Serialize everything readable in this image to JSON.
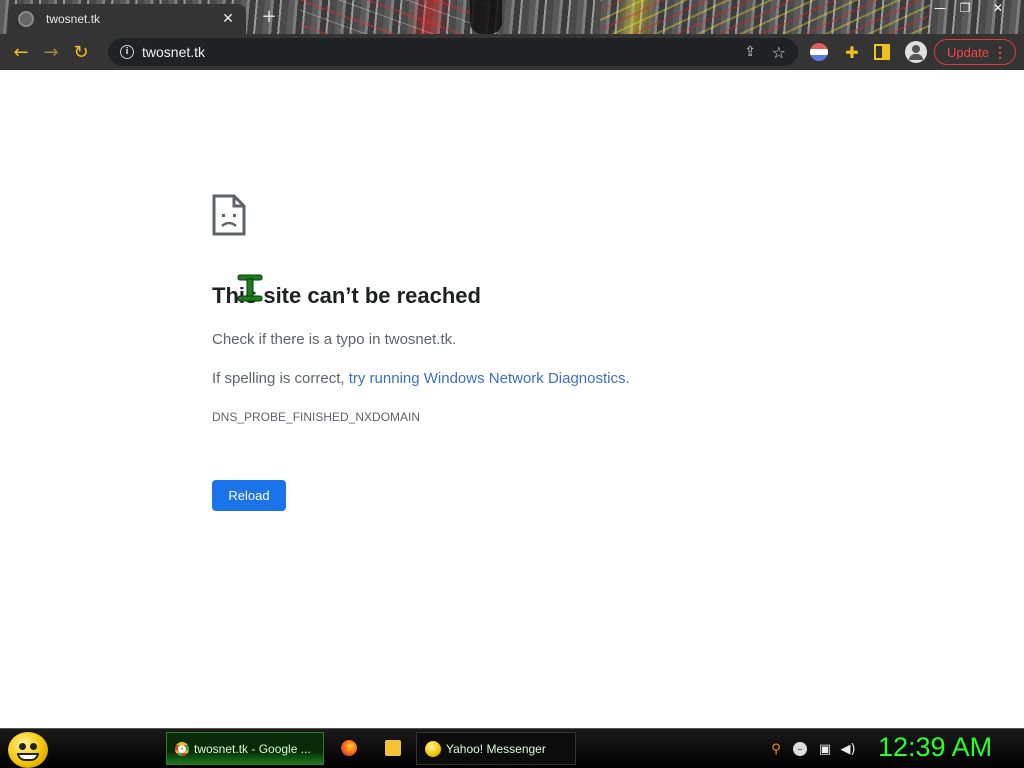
{
  "window": {
    "tab_title": "twosnet.tk",
    "tab_close": "✕",
    "new_tab": "+",
    "controls": {
      "minimize": "—",
      "maximize": "❐",
      "close": "✕"
    }
  },
  "toolbar": {
    "back": "←",
    "forward": "→",
    "reload": "↻",
    "url": "twosnet.tk",
    "info_glyph": "i",
    "share_glyph": "⇪",
    "star_glyph": "☆",
    "puzzle_glyph": "✚",
    "update_label": "Update",
    "menu_glyph": "⋮"
  },
  "error_page": {
    "headline": "This site can’t be reached",
    "check_text": "Check if there is a typo in twosnet.tk.",
    "spelling_prefix": "If spelling is correct, ",
    "diagnostics_link": "try running Windows Network Diagnostics",
    "spelling_suffix": ".",
    "error_code": "DNS_PROBE_FINISHED_NXDOMAIN",
    "reload_label": "Reload"
  },
  "taskbar": {
    "chrome_task": "twosnet.tk - Google ...",
    "yahoo_task": "Yahoo! Messenger",
    "tray_search": "⚲",
    "tray_mixer": "–",
    "tray_network": "▣",
    "tray_speaker": "◀)",
    "clock": "12:39 AM"
  },
  "colors": {
    "accent_yellow": "#f0c020",
    "update_red": "#f04848",
    "link_blue": "#3b6fc4",
    "button_blue": "#1a73e8",
    "clock_green": "#2bff2b"
  }
}
